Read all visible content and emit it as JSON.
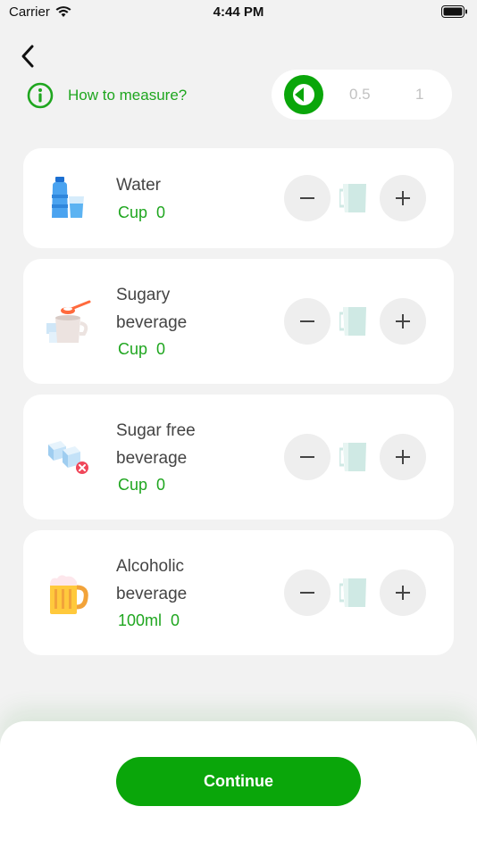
{
  "status_bar": {
    "carrier": "Carrier",
    "time": "4:44 PM"
  },
  "header": {
    "measure_link": "How to measure?",
    "size_options": [
      "0.5",
      "1"
    ]
  },
  "drinks": [
    {
      "title_lines": [
        "Water"
      ],
      "unit": "Cup",
      "count": "0",
      "icon": "water-bottle-icon"
    },
    {
      "title_lines": [
        "Sugary",
        "beverage"
      ],
      "unit": "Cup",
      "count": "0",
      "icon": "sugary-drink-icon"
    },
    {
      "title_lines": [
        "Sugar free",
        "beverage"
      ],
      "unit": "Cup",
      "count": "0",
      "icon": "sugar-free-icon"
    },
    {
      "title_lines": [
        "Alcoholic",
        "beverage"
      ],
      "unit": "100ml",
      "count": "0",
      "icon": "beer-icon"
    }
  ],
  "footer": {
    "continue_label": "Continue"
  },
  "colors": {
    "accent": "#0aa60a",
    "accent_text": "#1fa61f",
    "background": "#f2f2f2"
  }
}
